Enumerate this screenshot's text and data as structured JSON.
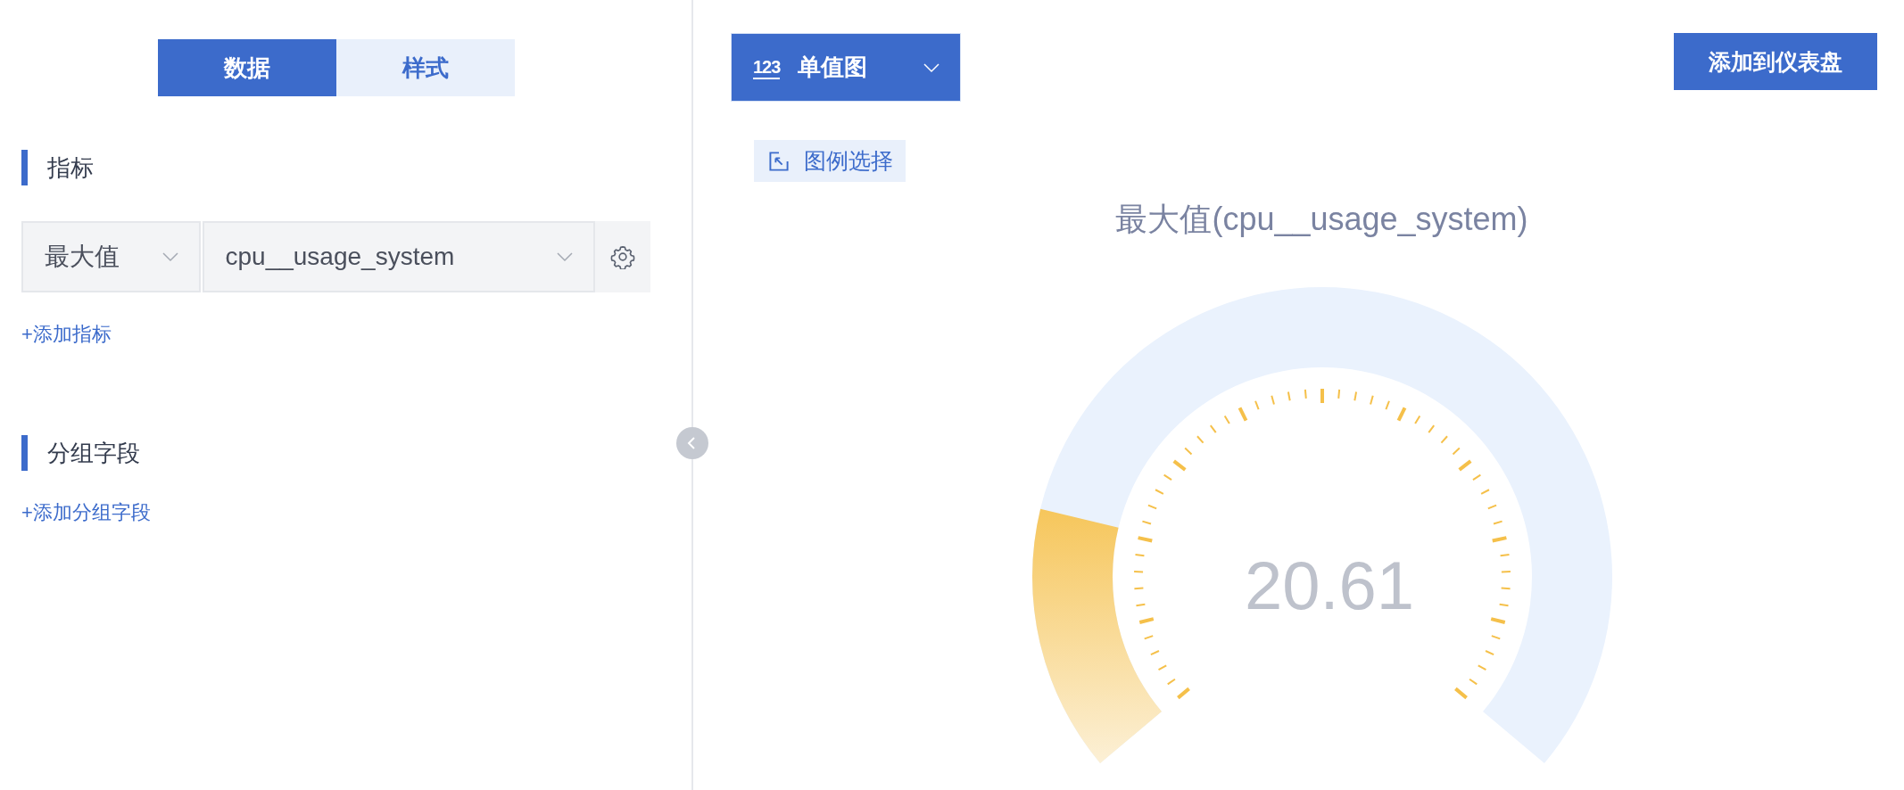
{
  "tabs": [
    {
      "label": "数据",
      "selected": true
    },
    {
      "label": "样式",
      "selected": false
    }
  ],
  "metrics_section": {
    "title": "指标",
    "metrics": [
      {
        "aggregation": "最大值",
        "field": "cpu__usage_system"
      }
    ],
    "add_link": "+添加指标"
  },
  "group_section": {
    "title": "分组字段",
    "add_link": "+添加分组字段"
  },
  "chart_type": {
    "icon_label": "123",
    "label": "单值图"
  },
  "add_button": "添加到仪表盘",
  "legend_button": "图例选择",
  "chart_title": "最大值(cpu__usage_system)",
  "gauge": {
    "value": "20.61",
    "level": 0.2061
  }
}
